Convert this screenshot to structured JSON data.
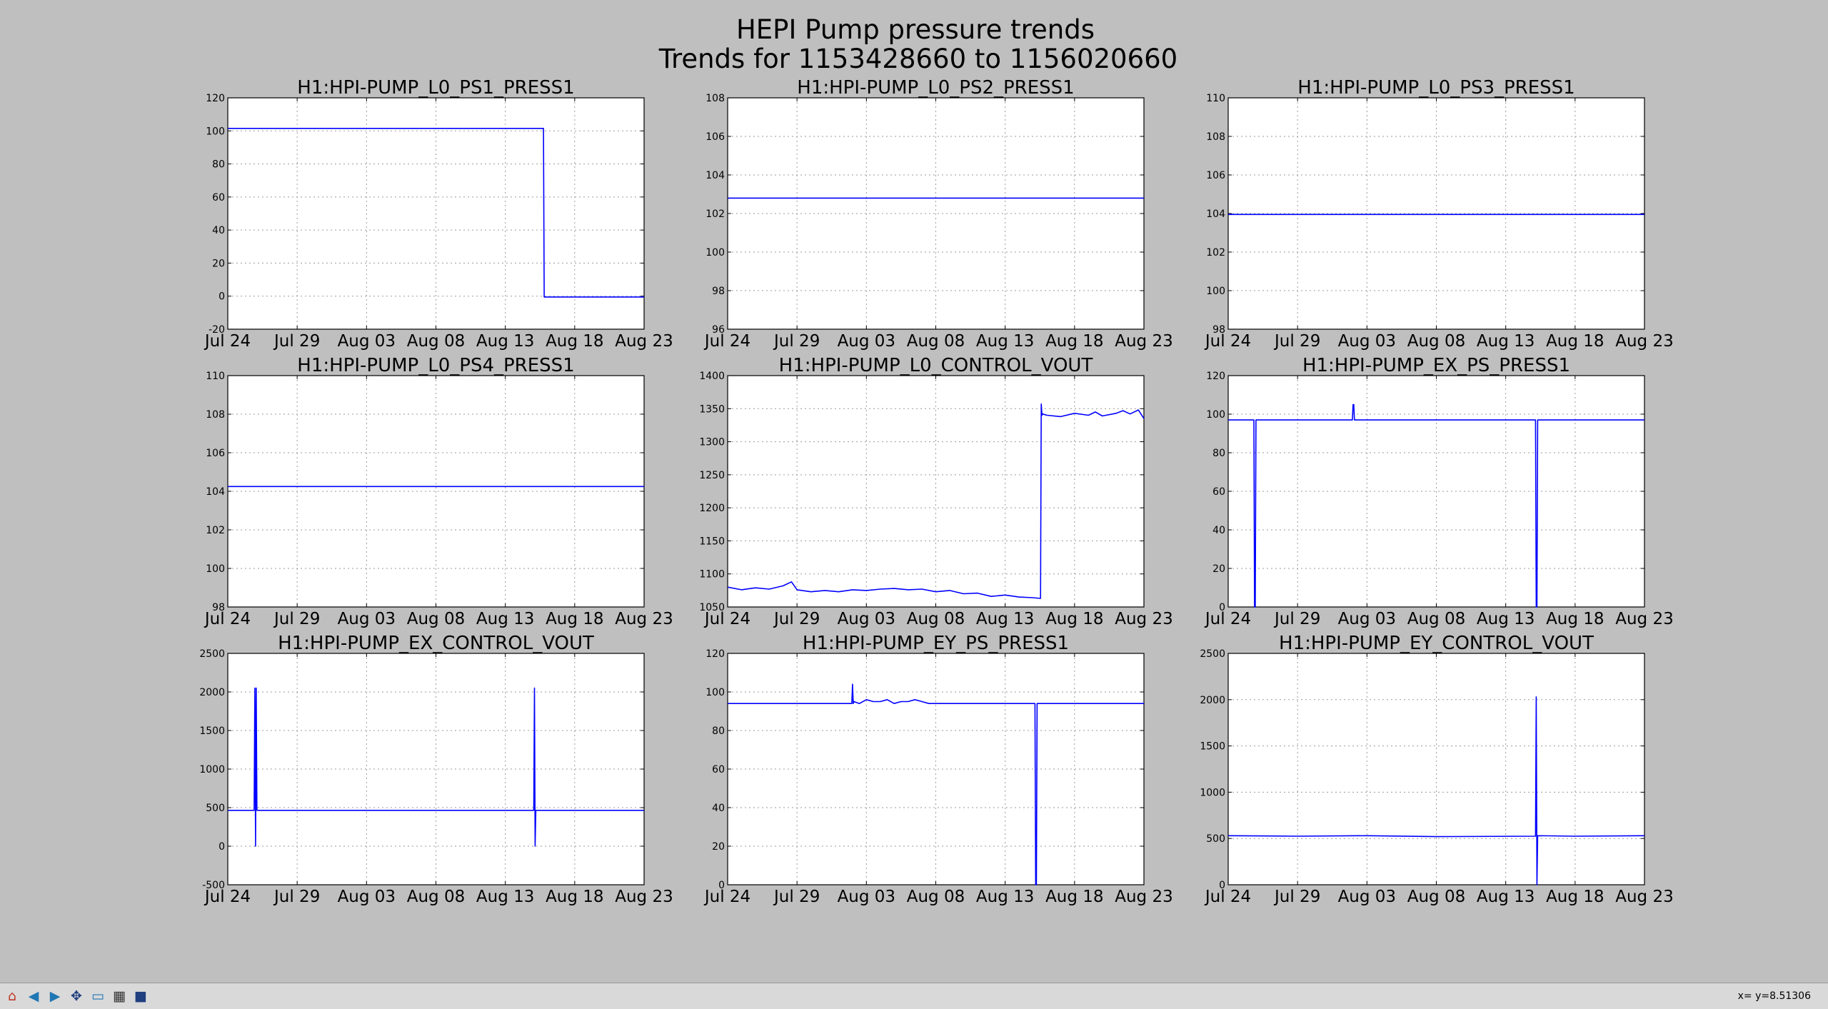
{
  "figure": {
    "title": "HEPI Pump pressure trends",
    "subtitle": "Trends for 1153428660 to 1156020660"
  },
  "toolbar": {
    "buttons": [
      {
        "name": "home-button",
        "icon": "home-icon",
        "glyph": "⌂",
        "color": "#c0392b"
      },
      {
        "name": "back-button",
        "icon": "arrow-left-icon",
        "glyph": "◀",
        "color": "#1f77b4"
      },
      {
        "name": "forward-button",
        "icon": "arrow-right-icon",
        "glyph": "▶",
        "color": "#1f77b4"
      },
      {
        "name": "pan-button",
        "icon": "move-icon",
        "glyph": "✥",
        "color": "#1f3f7f"
      },
      {
        "name": "zoom-button",
        "icon": "zoom-rect-icon",
        "glyph": "▭",
        "color": "#1f77b4"
      },
      {
        "name": "configure-button",
        "icon": "configure-subplots-icon",
        "glyph": "▦",
        "color": "#333333"
      },
      {
        "name": "save-button",
        "icon": "floppy-disk-icon",
        "glyph": "■",
        "color": "#1f3f7f"
      }
    ],
    "coords": "x= y=8.51306"
  },
  "chart_data": [
    {
      "type": "line",
      "title": "H1:HPI-PUMP_L0_PS1_PRESS1",
      "xlim": [
        0,
        30
      ],
      "x_tick_values": [
        0,
        5,
        10,
        15,
        20,
        25,
        30
      ],
      "x_tick_labels": [
        "Jul 24",
        "Jul 29",
        "Aug 03",
        "Aug 08",
        "Aug 13",
        "Aug 18",
        "Aug 23"
      ],
      "ylim": [
        -20,
        120
      ],
      "y_ticks": [
        -20,
        0,
        20,
        40,
        60,
        80,
        100,
        120
      ],
      "grid": true,
      "color": "#0000ff",
      "series": [
        {
          "x": [
            0,
            22.75,
            22.8,
            30
          ],
          "y": [
            101.5,
            101.5,
            -0.5,
            -0.5
          ]
        }
      ]
    },
    {
      "type": "line",
      "title": "H1:HPI-PUMP_L0_PS2_PRESS1",
      "xlim": [
        0,
        30
      ],
      "x_tick_values": [
        0,
        5,
        10,
        15,
        20,
        25,
        30
      ],
      "x_tick_labels": [
        "Jul 24",
        "Jul 29",
        "Aug 03",
        "Aug 08",
        "Aug 13",
        "Aug 18",
        "Aug 23"
      ],
      "ylim": [
        96,
        108
      ],
      "y_ticks": [
        96,
        98,
        100,
        102,
        104,
        106,
        108
      ],
      "grid": true,
      "color": "#0000ff",
      "series": [
        {
          "x": [
            0,
            30
          ],
          "y": [
            102.8,
            102.8
          ]
        }
      ]
    },
    {
      "type": "line",
      "title": "H1:HPI-PUMP_L0_PS3_PRESS1",
      "xlim": [
        0,
        30
      ],
      "x_tick_values": [
        0,
        5,
        10,
        15,
        20,
        25,
        30
      ],
      "x_tick_labels": [
        "Jul 24",
        "Jul 29",
        "Aug 03",
        "Aug 08",
        "Aug 13",
        "Aug 18",
        "Aug 23"
      ],
      "ylim": [
        98,
        110
      ],
      "y_ticks": [
        98,
        100,
        102,
        104,
        106,
        108,
        110
      ],
      "grid": true,
      "color": "#0000ff",
      "series": [
        {
          "x": [
            0,
            30
          ],
          "y": [
            103.95,
            103.95
          ]
        }
      ]
    },
    {
      "type": "line",
      "title": "H1:HPI-PUMP_L0_PS4_PRESS1",
      "xlim": [
        0,
        30
      ],
      "x_tick_values": [
        0,
        5,
        10,
        15,
        20,
        25,
        30
      ],
      "x_tick_labels": [
        "Jul 24",
        "Jul 29",
        "Aug 03",
        "Aug 08",
        "Aug 13",
        "Aug 18",
        "Aug 23"
      ],
      "ylim": [
        98,
        110
      ],
      "y_ticks": [
        98,
        100,
        102,
        104,
        106,
        108,
        110
      ],
      "grid": true,
      "color": "#0000ff",
      "series": [
        {
          "x": [
            0,
            30
          ],
          "y": [
            104.25,
            104.25
          ]
        }
      ]
    },
    {
      "type": "line",
      "title": "H1:HPI-PUMP_L0_CONTROL_VOUT",
      "xlim": [
        0,
        30
      ],
      "x_tick_values": [
        0,
        5,
        10,
        15,
        20,
        25,
        30
      ],
      "x_tick_labels": [
        "Jul 24",
        "Jul 29",
        "Aug 03",
        "Aug 08",
        "Aug 13",
        "Aug 18",
        "Aug 23"
      ],
      "ylim": [
        1050,
        1400
      ],
      "y_ticks": [
        1050,
        1100,
        1150,
        1200,
        1250,
        1300,
        1350,
        1400
      ],
      "grid": true,
      "color": "#0000ff",
      "series": [
        {
          "x": [
            0,
            1,
            2,
            3,
            4,
            4.6,
            5,
            6,
            7,
            8,
            9,
            10,
            11,
            12,
            13,
            14,
            15,
            16,
            17,
            18,
            19,
            20,
            21,
            22,
            22.55,
            22.6,
            22.65,
            22.7,
            23,
            24,
            25,
            26,
            26.5,
            27,
            28,
            28.5,
            29,
            29.6,
            30
          ],
          "y": [
            1080,
            1076,
            1079,
            1077,
            1082,
            1088,
            1076,
            1073,
            1075,
            1073,
            1076,
            1075,
            1077,
            1078,
            1076,
            1077,
            1073,
            1075,
            1070,
            1071,
            1066,
            1068,
            1065,
            1064,
            1063,
            1357,
            1340,
            1342,
            1340,
            1338,
            1343,
            1340,
            1345,
            1339,
            1343,
            1347,
            1342,
            1348,
            1335
          ]
        }
      ]
    },
    {
      "type": "line",
      "title": "H1:HPI-PUMP_EX_PS_PRESS1",
      "xlim": [
        0,
        30
      ],
      "x_tick_values": [
        0,
        5,
        10,
        15,
        20,
        25,
        30
      ],
      "x_tick_labels": [
        "Jul 24",
        "Jul 29",
        "Aug 03",
        "Aug 08",
        "Aug 13",
        "Aug 18",
        "Aug 23"
      ],
      "ylim": [
        0,
        120
      ],
      "y_ticks": [
        0,
        20,
        40,
        60,
        80,
        100,
        120
      ],
      "grid": true,
      "color": "#0000ff",
      "series": [
        {
          "x": [
            0,
            1.85,
            1.9,
            1.95,
            2.0,
            8.95,
            9.0,
            9.05,
            9.1,
            22.15,
            22.2,
            22.25,
            22.3,
            30
          ],
          "y": [
            97,
            97,
            0,
            0,
            97,
            97,
            105,
            105,
            97,
            97,
            0,
            0,
            97,
            97
          ]
        }
      ]
    },
    {
      "type": "line",
      "title": "H1:HPI-PUMP_EX_CONTROL_VOUT",
      "xlim": [
        0,
        30
      ],
      "x_tick_values": [
        0,
        5,
        10,
        15,
        20,
        25,
        30
      ],
      "x_tick_labels": [
        "Jul 24",
        "Jul 29",
        "Aug 03",
        "Aug 08",
        "Aug 13",
        "Aug 18",
        "Aug 23"
      ],
      "ylim": [
        -500,
        2500
      ],
      "y_ticks": [
        -500,
        0,
        500,
        1000,
        1500,
        2000,
        2500
      ],
      "grid": true,
      "color": "#0000ff",
      "series": [
        {
          "x": [
            0,
            1.9,
            1.95,
            2.0,
            2.05,
            2.1,
            22.05,
            22.1,
            22.15,
            22.2,
            30
          ],
          "y": [
            465,
            465,
            2050,
            0,
            2050,
            465,
            465,
            2050,
            0,
            465,
            465
          ]
        }
      ]
    },
    {
      "type": "line",
      "title": "H1:HPI-PUMP_EY_PS_PRESS1",
      "xlim": [
        0,
        30
      ],
      "x_tick_values": [
        0,
        5,
        10,
        15,
        20,
        25,
        30
      ],
      "x_tick_labels": [
        "Jul 24",
        "Jul 29",
        "Aug 03",
        "Aug 08",
        "Aug 13",
        "Aug 18",
        "Aug 23"
      ],
      "ylim": [
        0,
        120
      ],
      "y_ticks": [
        0,
        20,
        40,
        60,
        80,
        100,
        120
      ],
      "grid": true,
      "color": "#0000ff",
      "series": [
        {
          "x": [
            0,
            8.95,
            9.0,
            9.05,
            9.1,
            9.5,
            10,
            10.5,
            11,
            11.5,
            12,
            12.5,
            13,
            13.5,
            14,
            14.5,
            15,
            22.15,
            22.2,
            22.25,
            22.3,
            30
          ],
          "y": [
            94,
            94,
            104,
            94,
            95,
            94,
            96,
            95,
            95,
            96,
            94,
            95,
            95,
            96,
            95,
            94,
            94,
            94,
            0,
            0,
            94,
            94
          ]
        }
      ]
    },
    {
      "type": "line",
      "title": "H1:HPI-PUMP_EY_CONTROL_VOUT",
      "xlim": [
        0,
        30
      ],
      "x_tick_values": [
        0,
        5,
        10,
        15,
        20,
        25,
        30
      ],
      "x_tick_labels": [
        "Jul 24",
        "Jul 29",
        "Aug 03",
        "Aug 08",
        "Aug 13",
        "Aug 18",
        "Aug 23"
      ],
      "ylim": [
        0,
        2500
      ],
      "y_ticks": [
        0,
        500,
        1000,
        1500,
        2000,
        2500
      ],
      "grid": true,
      "color": "#0000ff",
      "series": [
        {
          "x": [
            0,
            5,
            10,
            15,
            22.15,
            22.2,
            22.25,
            22.3,
            25,
            30
          ],
          "y": [
            530,
            525,
            530,
            520,
            525,
            2030,
            0,
            530,
            525,
            530
          ]
        }
      ]
    }
  ]
}
